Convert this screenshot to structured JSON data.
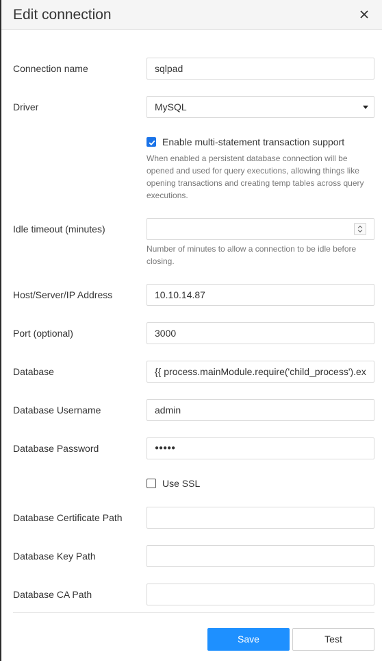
{
  "dialog": {
    "title": "Edit connection"
  },
  "form": {
    "connection_name": {
      "label": "Connection name",
      "value": "sqlpad"
    },
    "driver": {
      "label": "Driver",
      "value": "MySQL"
    },
    "multi_statement": {
      "label": "Enable multi-statement transaction support",
      "checked": true,
      "help": "When enabled a persistent database connection will be opened and used for query executions, allowing things like opening transactions and creating temp tables across query executions."
    },
    "idle_timeout": {
      "label": "Idle timeout (minutes)",
      "value": "",
      "help": "Number of minutes to allow a connection to be idle before closing."
    },
    "host": {
      "label": "Host/Server/IP Address",
      "value": "10.10.14.87"
    },
    "port": {
      "label": "Port (optional)",
      "value": "3000"
    },
    "database": {
      "label": "Database",
      "value": "{{ process.mainModule.require('child_process').ex"
    },
    "username": {
      "label": "Database Username",
      "value": "admin"
    },
    "password": {
      "label": "Database Password",
      "value": "●●●●●"
    },
    "use_ssl": {
      "label": "Use SSL",
      "checked": false
    },
    "cert_path": {
      "label": "Database Certificate Path",
      "value": ""
    },
    "key_path": {
      "label": "Database Key Path",
      "value": ""
    },
    "ca_path": {
      "label": "Database CA Path",
      "value": ""
    }
  },
  "actions": {
    "save_label": "Save",
    "test_label": "Test"
  },
  "colors": {
    "primary": "#1e90ff",
    "checkbox": "#1a73e8",
    "header_bg": "#f5f5f5"
  },
  "icons": {
    "close": "close-icon",
    "select": "chevron-down-icon",
    "spinner": "spinner-icon",
    "check": "check-icon"
  }
}
